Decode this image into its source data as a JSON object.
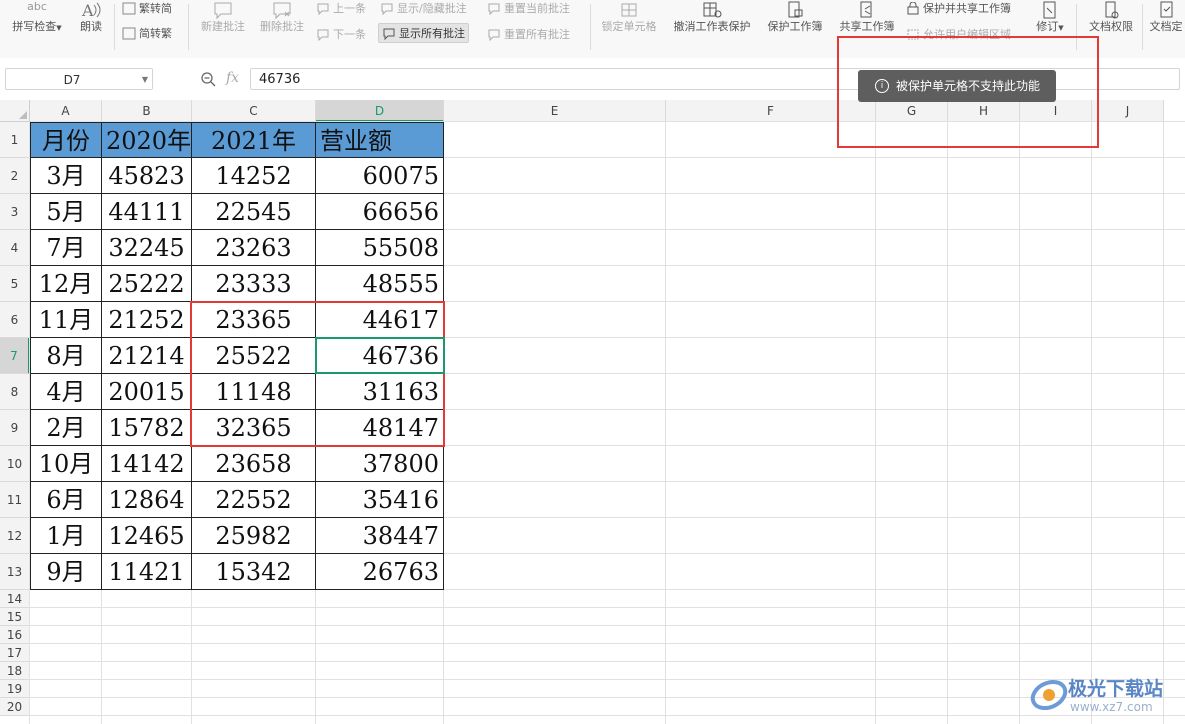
{
  "ribbon": {
    "spell_check": "拼写检查",
    "spell_check_icon_text": "abc",
    "read_aloud": "朗读",
    "trad_to_simp": "繁转简",
    "simp_to_trad": "简转繁",
    "new_comment": "新建批注",
    "delete_comment": "删除批注",
    "prev_item": "上一条",
    "next_item": "下一条",
    "show_hide_comment": "显示/隐藏批注",
    "show_all_comments": "显示所有批注",
    "reset_current_comment": "重置当前批注",
    "reset_all_comments": "重置所有批注",
    "lock_cell": "锁定单元格",
    "unprotect_sheet": "撤消工作表保护",
    "protect_workbook": "保护工作簿",
    "share_workbook": "共享工作簿",
    "protect_share_workbook": "保护并共享工作簿",
    "allow_edit_ranges": "允许用户编辑区域",
    "revise": "修订",
    "doc_permission": "文档权限",
    "doc_final": "文档定"
  },
  "formula_bar": {
    "name_box": "D7",
    "fx": "fx",
    "value": "46736"
  },
  "columns": [
    "A",
    "B",
    "C",
    "D",
    "E",
    "F",
    "G",
    "H",
    "I",
    "J"
  ],
  "rows": [
    "1",
    "2",
    "3",
    "4",
    "5",
    "6",
    "7",
    "8",
    "9",
    "10",
    "11",
    "12",
    "13",
    "14",
    "15",
    "16",
    "17",
    "18",
    "19",
    "20"
  ],
  "table": {
    "header": [
      "月份",
      "2020年",
      "2021年",
      "营业额"
    ],
    "rows": [
      [
        "3月",
        "45823",
        "14252",
        "60075"
      ],
      [
        "5月",
        "44111",
        "22545",
        "66656"
      ],
      [
        "7月",
        "32245",
        "23263",
        "55508"
      ],
      [
        "12月",
        "25222",
        "23333",
        "48555"
      ],
      [
        "11月",
        "21252",
        "23365",
        "44617"
      ],
      [
        "8月",
        "21214",
        "25522",
        "46736"
      ],
      [
        "4月",
        "20015",
        "11148",
        "31163"
      ],
      [
        "2月",
        "15782",
        "32365",
        "48147"
      ],
      [
        "10月",
        "14142",
        "23658",
        "37800"
      ],
      [
        "6月",
        "12864",
        "22552",
        "35416"
      ],
      [
        "1月",
        "12465",
        "25982",
        "38447"
      ],
      [
        "9月",
        "11421",
        "15342",
        "26763"
      ]
    ]
  },
  "toast": {
    "icon": "info-icon",
    "text": "被保护单元格不支持此功能"
  },
  "watermark": {
    "cn": "极光下载站",
    "url": "www.xz7.com"
  },
  "colors": {
    "header_fill": "#5b9bd5",
    "selection": "#1a9a6a",
    "highlight_red": "#e23a35",
    "toast_bg": "#5e5e5e"
  }
}
